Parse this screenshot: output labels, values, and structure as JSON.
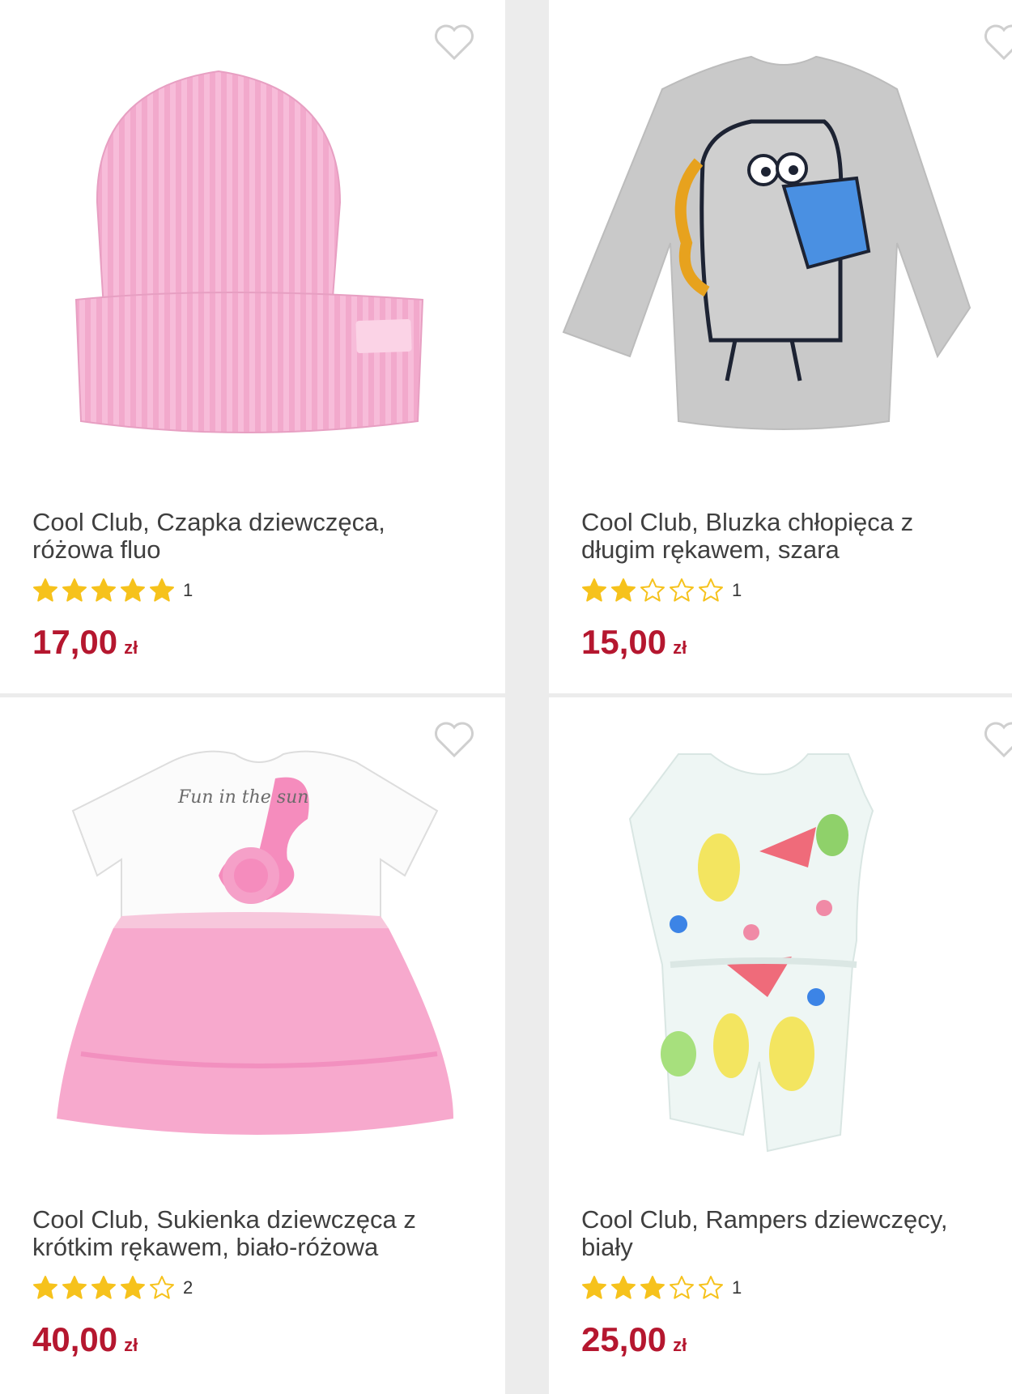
{
  "colors": {
    "price": "#b5172f",
    "star": "#f6c21c",
    "heart": "#cfcfcf"
  },
  "products": [
    {
      "title_line1": "Cool Club, Czapka dziewczęca,",
      "title_line2": "różowa fluo",
      "rating": 5,
      "rating_count": "1",
      "price": "17,00",
      "currency": "zł",
      "image": "pink-knit-beanie"
    },
    {
      "title_line1": "Cool Club, Bluzka chłopięca z",
      "title_line2": "długim rękawem, szara",
      "rating": 2,
      "rating_count": "1",
      "price": "15,00",
      "currency": "zł",
      "image": "grey-longsleeve-dino-reading"
    },
    {
      "title_line1": "Cool Club, Sukienka dziewczęca z",
      "title_line2": "krótkim rękawem, biało-różowa",
      "rating": 4,
      "rating_count": "2",
      "price": "40,00",
      "currency": "zł",
      "image": "flamingo-tutu-dress",
      "print_text": "Fun in the sun"
    },
    {
      "title_line1": "Cool Club, Rampers dziewczęcy,",
      "title_line2": "biały",
      "rating": 3,
      "rating_count": "1",
      "price": "25,00",
      "currency": "zł",
      "image": "fruit-print-romper"
    }
  ]
}
